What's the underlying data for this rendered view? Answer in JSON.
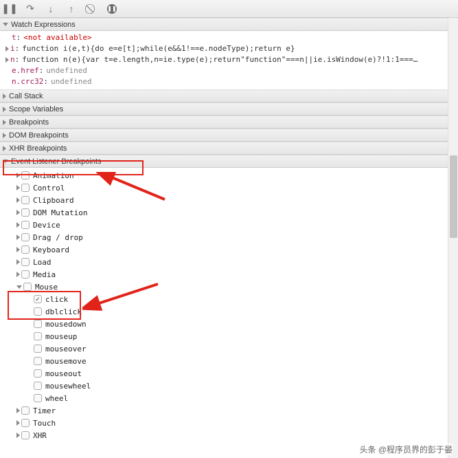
{
  "toolbar": {
    "pause": "❚❚",
    "step_over": "↷",
    "step_into": "↓",
    "step_out": "↑",
    "deactivate": "⃠",
    "pause_exceptions": "⏸"
  },
  "watch": {
    "title": "Watch Expressions",
    "rows": [
      {
        "key": "t",
        "val": "<not available>",
        "cls": "notavail",
        "exp": false
      },
      {
        "key": "i",
        "val": "function i(e,t){do e=e[t];while(e&&1!==e.nodeType);return e}",
        "cls": "",
        "exp": true
      },
      {
        "key": "n",
        "val": "function n(e){var t=e.length,n=ie.type(e);return\"function\"===n||ie.isWindow(e)?!1:1===…",
        "cls": "",
        "exp": true
      },
      {
        "key": "e.href",
        "val": "undefined",
        "cls": "undef",
        "exp": false
      },
      {
        "key": "n.crc32",
        "val": "undefined",
        "cls": "undef",
        "exp": false
      }
    ]
  },
  "sections": {
    "call_stack": "Call Stack",
    "scope_variables": "Scope Variables",
    "breakpoints": "Breakpoints",
    "dom_breakpoints": "DOM Breakpoints",
    "xhr_breakpoints": "XHR Breakpoints",
    "event_listener_breakpoints": "Event Listener Breakpoints"
  },
  "event_categories": [
    {
      "label": "Animation",
      "expanded": false,
      "checked": false
    },
    {
      "label": "Control",
      "expanded": false,
      "checked": false
    },
    {
      "label": "Clipboard",
      "expanded": false,
      "checked": false
    },
    {
      "label": "DOM Mutation",
      "expanded": false,
      "checked": false
    },
    {
      "label": "Device",
      "expanded": false,
      "checked": false
    },
    {
      "label": "Drag / drop",
      "expanded": false,
      "checked": false
    },
    {
      "label": "Keyboard",
      "expanded": false,
      "checked": false
    },
    {
      "label": "Load",
      "expanded": false,
      "checked": false
    },
    {
      "label": "Media",
      "expanded": false,
      "checked": false
    },
    {
      "label": "Mouse",
      "expanded": true,
      "checked": false,
      "children": [
        {
          "label": "click",
          "checked": true
        },
        {
          "label": "dblclick",
          "checked": false
        },
        {
          "label": "mousedown",
          "checked": false
        },
        {
          "label": "mouseup",
          "checked": false
        },
        {
          "label": "mouseover",
          "checked": false
        },
        {
          "label": "mousemove",
          "checked": false
        },
        {
          "label": "mouseout",
          "checked": false
        },
        {
          "label": "mousewheel",
          "checked": false
        },
        {
          "label": "wheel",
          "checked": false
        }
      ]
    },
    {
      "label": "Timer",
      "expanded": false,
      "checked": false
    },
    {
      "label": "Touch",
      "expanded": false,
      "checked": false
    },
    {
      "label": "XHR",
      "expanded": false,
      "checked": false
    }
  ],
  "watermark": "头条 @程序员界的彭于晏"
}
